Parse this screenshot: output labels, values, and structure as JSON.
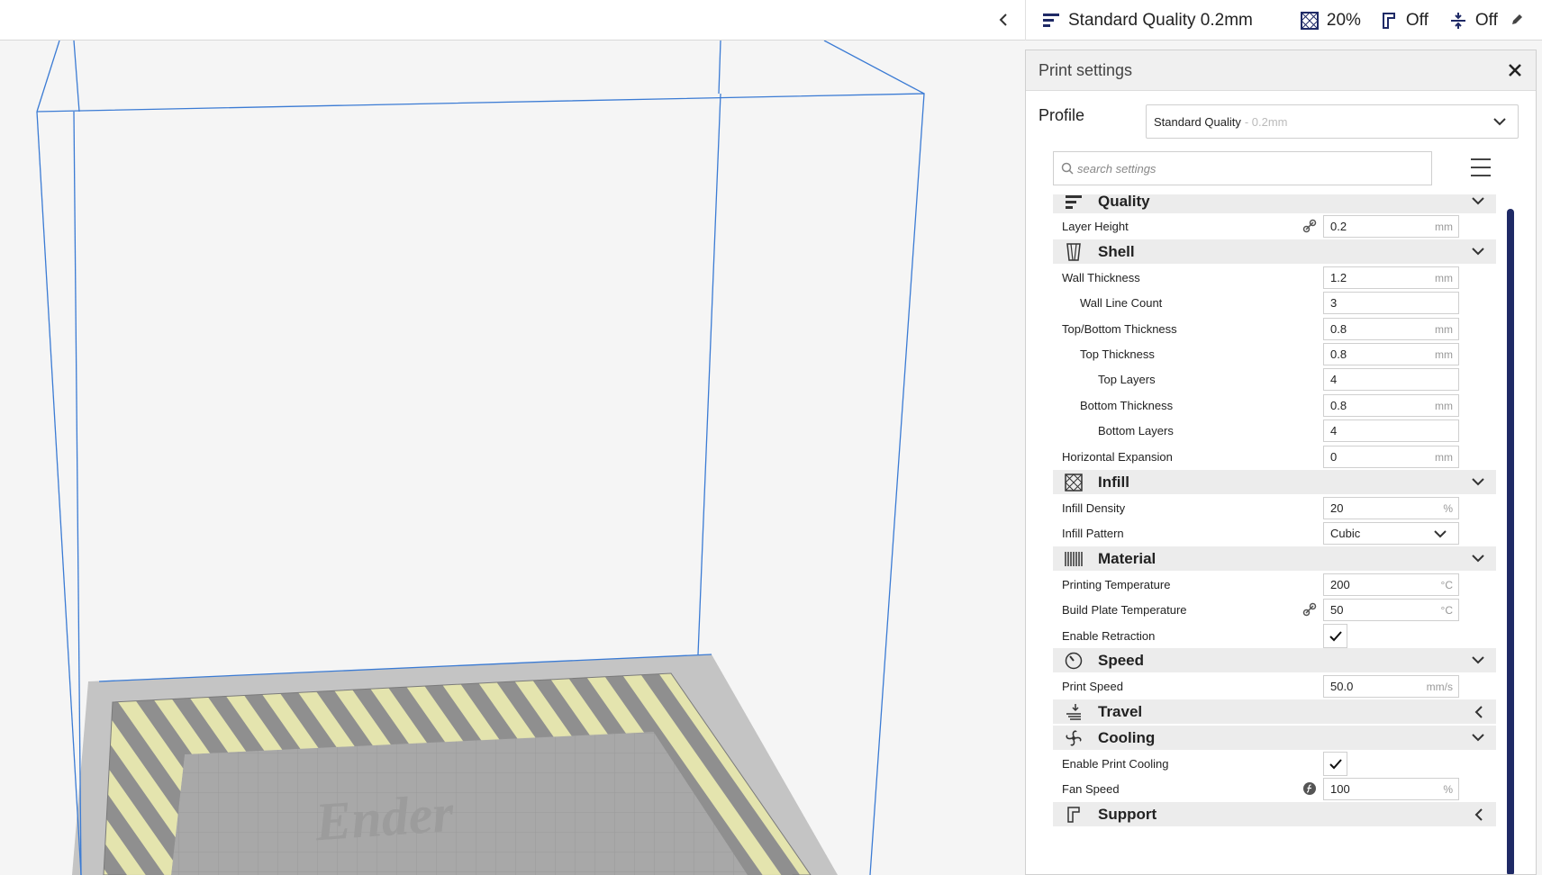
{
  "header": {
    "profile_name": "Standard Quality 0.2mm",
    "infill_value": "20%",
    "support_value": "Off",
    "adhesion_value": "Off"
  },
  "viewport": {
    "bed_logo": "Ender"
  },
  "panel": {
    "title": "Print settings",
    "profile_label": "Profile",
    "profile_value": "Standard Quality",
    "profile_sub": "- 0.2mm",
    "search_placeholder": "search settings"
  },
  "categories": {
    "quality": "Quality",
    "shell": "Shell",
    "infill": "Infill",
    "material": "Material",
    "speed": "Speed",
    "travel": "Travel",
    "cooling": "Cooling",
    "support": "Support"
  },
  "settings": {
    "layer_height": {
      "label": "Layer Height",
      "value": "0.2",
      "unit": "mm"
    },
    "wall_thickness": {
      "label": "Wall Thickness",
      "value": "1.2",
      "unit": "mm"
    },
    "wall_line_count": {
      "label": "Wall Line Count",
      "value": "3"
    },
    "top_bottom_thickness": {
      "label": "Top/Bottom Thickness",
      "value": "0.8",
      "unit": "mm"
    },
    "top_thickness": {
      "label": "Top Thickness",
      "value": "0.8",
      "unit": "mm"
    },
    "top_layers": {
      "label": "Top Layers",
      "value": "4"
    },
    "bottom_thickness": {
      "label": "Bottom Thickness",
      "value": "0.8",
      "unit": "mm"
    },
    "bottom_layers": {
      "label": "Bottom Layers",
      "value": "4"
    },
    "horizontal_expansion": {
      "label": "Horizontal Expansion",
      "value": "0",
      "unit": "mm"
    },
    "infill_density": {
      "label": "Infill Density",
      "value": "20",
      "unit": "%"
    },
    "infill_pattern": {
      "label": "Infill Pattern",
      "value": "Cubic"
    },
    "printing_temperature": {
      "label": "Printing Temperature",
      "value": "200",
      "unit": "°C"
    },
    "build_plate_temperature": {
      "label": "Build Plate Temperature",
      "value": "50",
      "unit": "°C"
    },
    "enable_retraction": {
      "label": "Enable Retraction",
      "checked": true
    },
    "print_speed": {
      "label": "Print Speed",
      "value": "50.0",
      "unit": "mm/s"
    },
    "enable_print_cooling": {
      "label": "Enable Print Cooling",
      "checked": true
    },
    "fan_speed": {
      "label": "Fan Speed",
      "value": "100",
      "unit": "%"
    }
  },
  "colors": {
    "build_volume_lines": "#3b7bd4",
    "scrollbar": "#1f2a66",
    "stripe_light": "#e6e6b0",
    "stripe_dark": "#8a8a8a"
  }
}
